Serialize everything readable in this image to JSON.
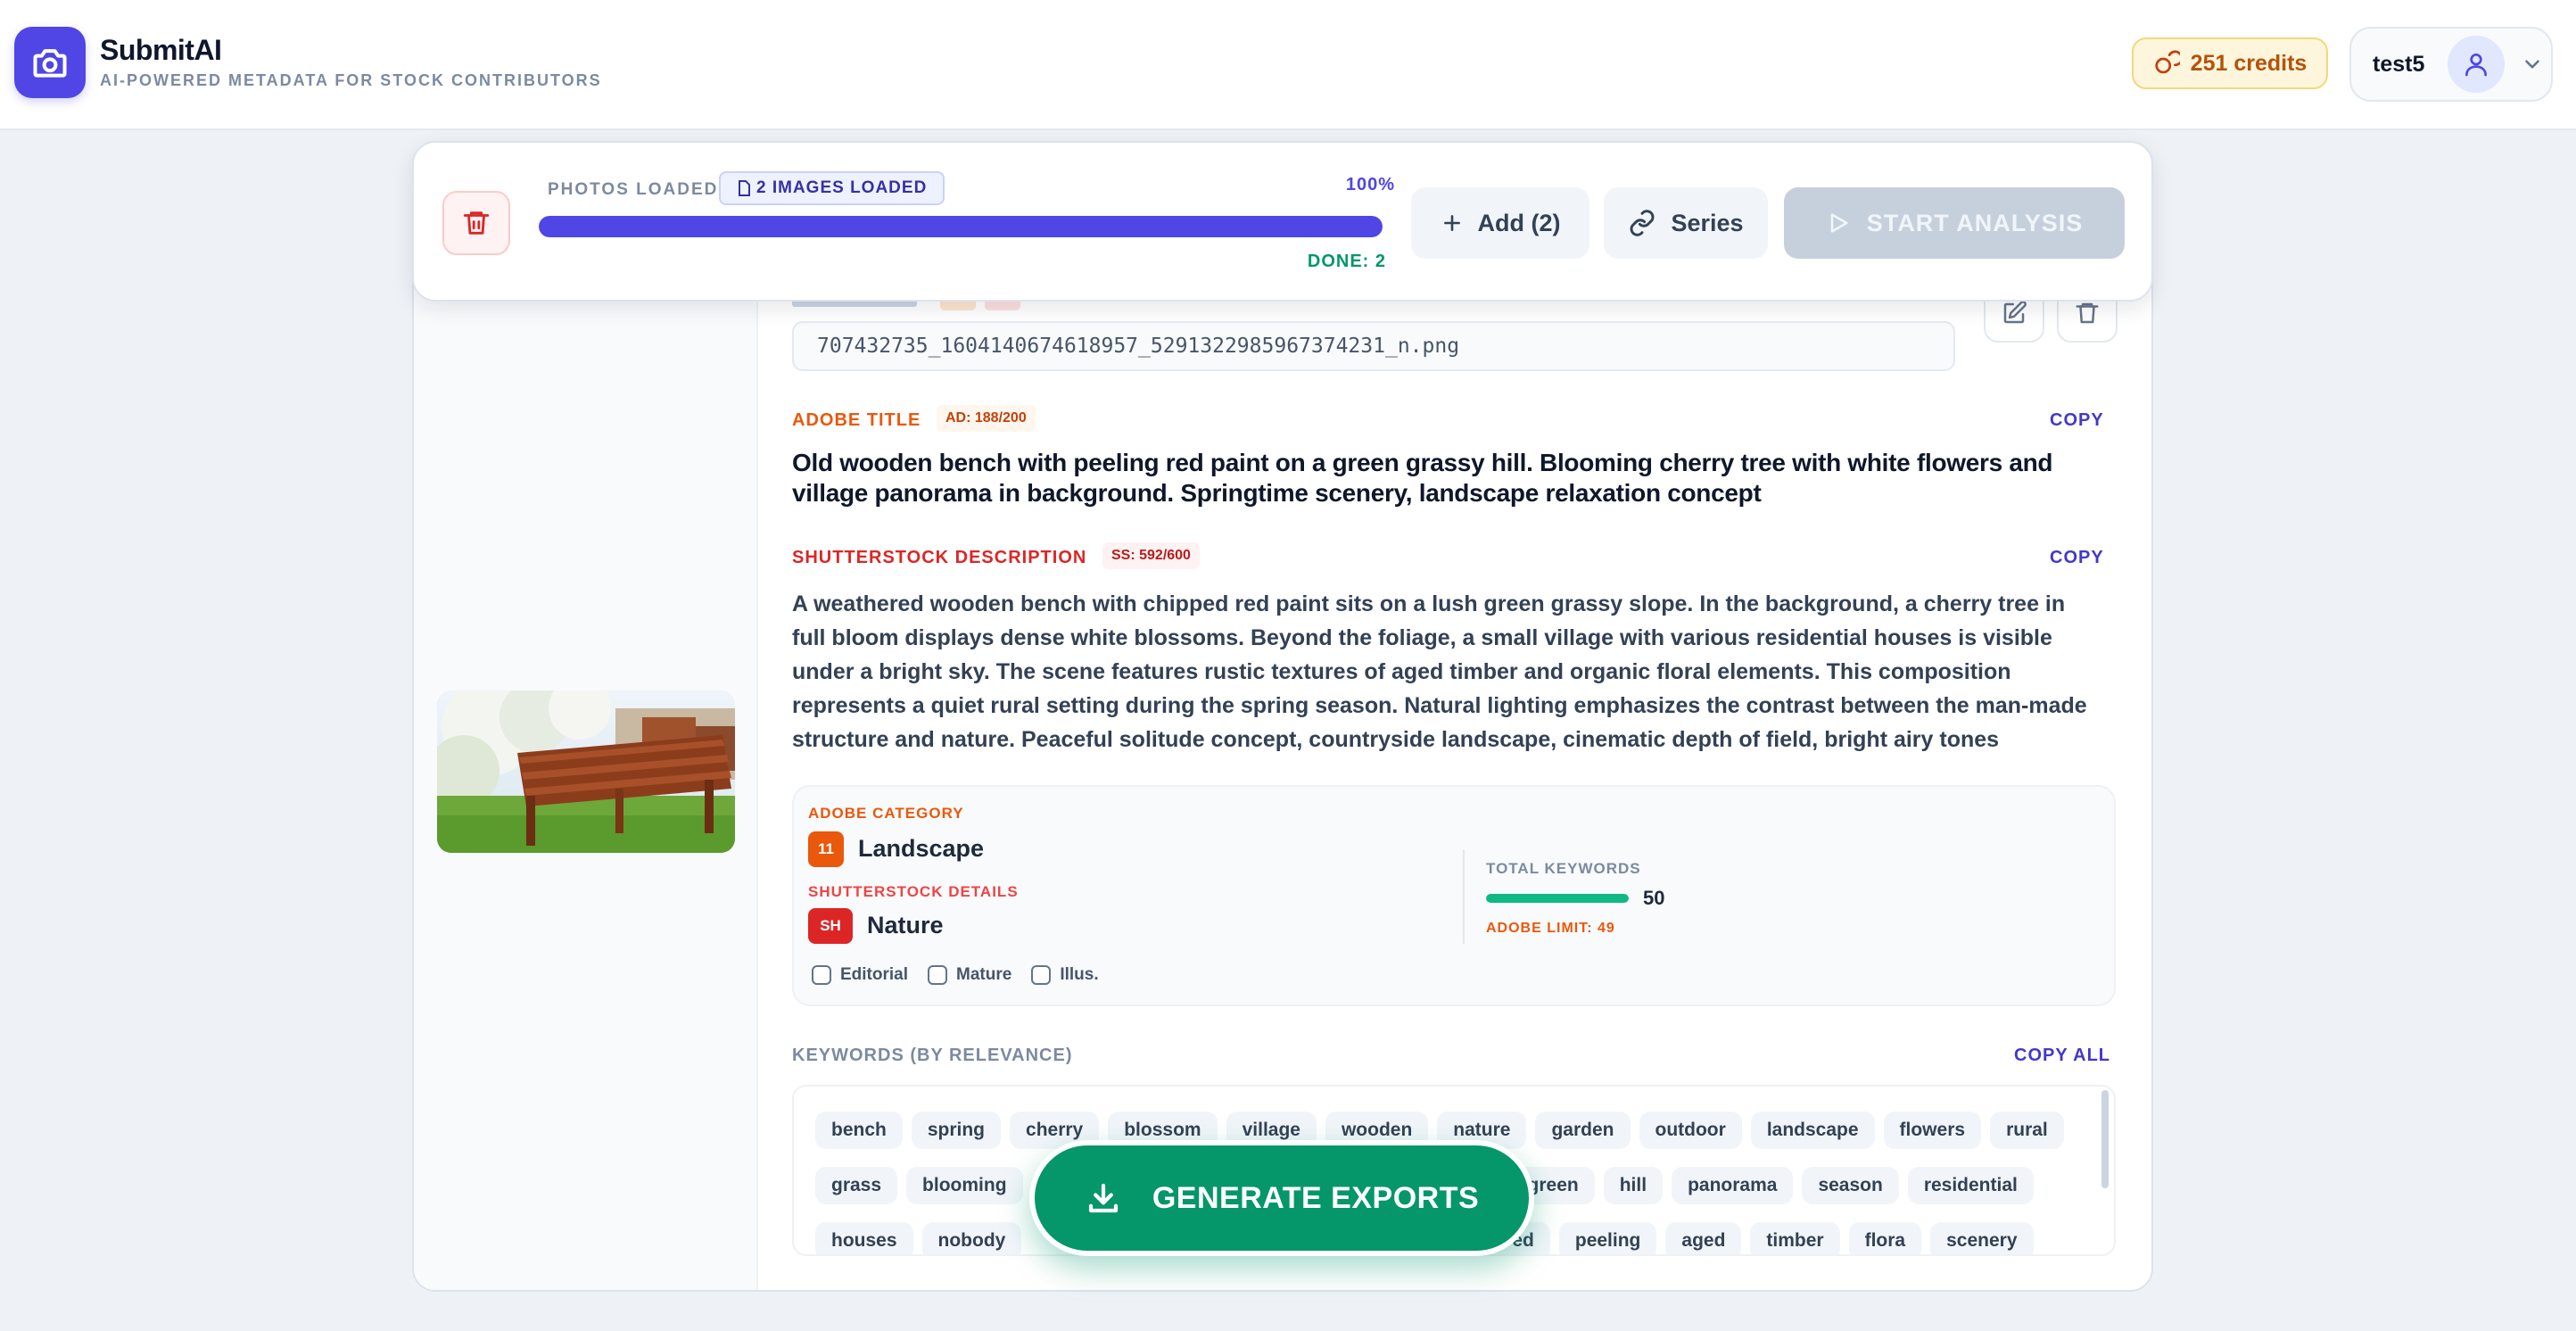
{
  "header": {
    "app_name": "SubmitAI",
    "tagline": "AI-POWERED METADATA FOR STOCK CONTRIBUTORS",
    "credits": "251 credits",
    "username": "test5"
  },
  "toolbar": {
    "photos_label": "PHOTOS LOADED",
    "images_loaded": "2 IMAGES LOADED",
    "progress_percent": "100%",
    "progress_value": 100,
    "done_label": "DONE: 2",
    "add_label": "Add (2)",
    "series_label": "Series",
    "start_label": "START ANALYSIS"
  },
  "file": {
    "filename": "707432735_1604140674618957_5291322985967374231_n.png"
  },
  "adobe_title": {
    "label": "ADOBE TITLE",
    "counter": "AD: 188/200",
    "copy": "COPY",
    "text": "Old wooden bench with peeling red paint on a green grassy hill. Blooming cherry tree with white flowers and village panorama in background. Springtime scenery, landscape relaxation concept"
  },
  "shutterstock_desc": {
    "label": "SHUTTERSTOCK DESCRIPTION",
    "counter": "SS: 592/600",
    "copy": "COPY",
    "text": "A weathered wooden bench with chipped red paint sits on a lush green grassy slope. In the background, a cherry tree in full bloom displays dense white blossoms. Beyond the foliage, a small village with various residential houses is visible under a bright sky. The scene features rustic textures of aged timber and organic floral elements. This composition represents a quiet rural setting during the spring season. Natural lighting emphasizes the contrast between the man-made structure and nature. Peaceful solitude concept, countryside landscape, cinematic depth of field, bright airy tones"
  },
  "categories": {
    "adobe_label": "ADOBE CATEGORY",
    "adobe_code": "11",
    "adobe_name": "Landscape",
    "ss_label": "SHUTTERSTOCK DETAILS",
    "ss_code": "SH",
    "ss_name": "Nature",
    "total_label": "TOTAL KEYWORDS",
    "total_count": "50",
    "keyword_fill": 1,
    "adobe_limit": "ADOBE LIMIT: 49",
    "checks": [
      "Editorial",
      "Mature",
      "Illus."
    ]
  },
  "keywords": {
    "label": "KEYWORDS (BY RELEVANCE)",
    "copy_all": "COPY ALL",
    "row1": [
      "bench",
      "spring",
      "cherry",
      "blossom",
      "village",
      "wooden",
      "nature",
      "garden",
      "outdoor",
      "landscape",
      "flowers",
      "rural"
    ],
    "row2a": [
      "grass",
      "blooming"
    ],
    "row2b": [
      "green",
      "hill",
      "panorama",
      "season",
      "residential"
    ],
    "row3a": [
      "houses",
      "nobody"
    ],
    "row3b": [
      "ed",
      "peeling",
      "aged",
      "timber",
      "flora",
      "scenery"
    ]
  },
  "generate": {
    "label": "GENERATE EXPORTS"
  },
  "colors": {
    "primary": "#4f46e5",
    "success": "#059669",
    "adobe": "#ea580c",
    "shutterstock": "#dc2626"
  }
}
